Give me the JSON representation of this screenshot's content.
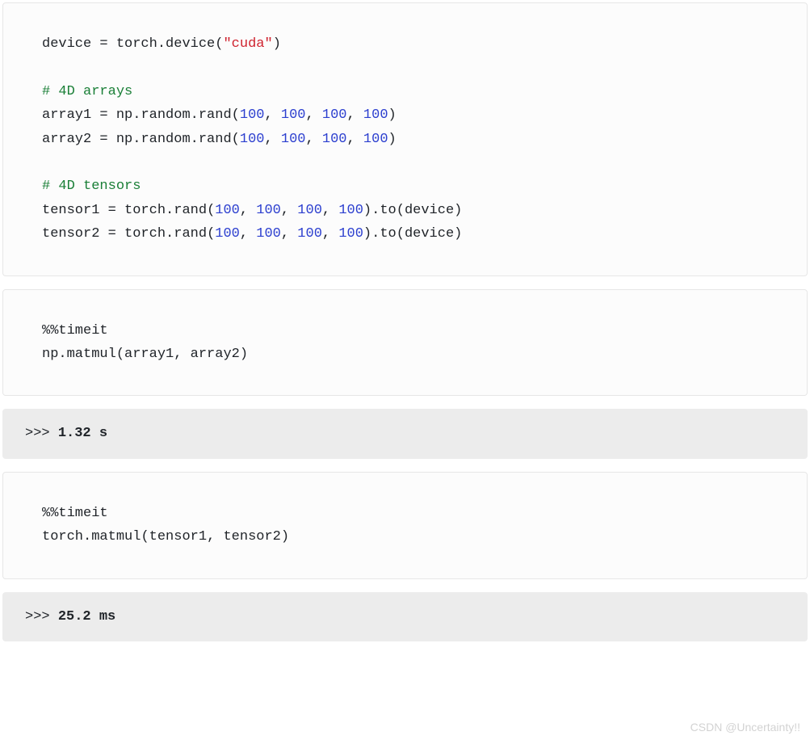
{
  "block1": {
    "l1_lhs": "device",
    "l1_eq": " = ",
    "l1_mod": "torch",
    "l1_dot1": ".",
    "l1_fn": "device",
    "l1_open": "(",
    "l1_str": "\"cuda\"",
    "l1_close": ")",
    "blank1": "",
    "c1": "# 4D arrays",
    "a1_lhs": "array1",
    "a1_eq": " = ",
    "a1_np": "np",
    "a1_d1": ".",
    "a1_rnd": "random",
    "a1_d2": ".",
    "a1_rand": "rand",
    "a1_open": "(",
    "a1_n1": "100",
    "a1_c1": ", ",
    "a1_n2": "100",
    "a1_c2": ", ",
    "a1_n3": "100",
    "a1_c3": ", ",
    "a1_n4": "100",
    "a1_close": ")",
    "a2_lhs": "array2",
    "a2_eq": " = ",
    "a2_np": "np",
    "a2_d1": ".",
    "a2_rnd": "random",
    "a2_d2": ".",
    "a2_rand": "rand",
    "a2_open": "(",
    "a2_n1": "100",
    "a2_c1": ", ",
    "a2_n2": "100",
    "a2_c2": ", ",
    "a2_n3": "100",
    "a2_c3": ", ",
    "a2_n4": "100",
    "a2_close": ")",
    "blank2": "",
    "c2": "# 4D tensors",
    "t1_lhs": "tensor1",
    "t1_eq": " = ",
    "t1_mod": "torch",
    "t1_d1": ".",
    "t1_rand": "rand",
    "t1_open": "(",
    "t1_n1": "100",
    "t1_c1": ", ",
    "t1_n2": "100",
    "t1_c2": ", ",
    "t1_n3": "100",
    "t1_c3": ", ",
    "t1_n4": "100",
    "t1_close": ")",
    "t1_d2": ".",
    "t1_to": "to",
    "t1_open2": "(",
    "t1_dev": "device",
    "t1_close2": ")",
    "t2_lhs": "tensor2",
    "t2_eq": " = ",
    "t2_mod": "torch",
    "t2_d1": ".",
    "t2_rand": "rand",
    "t2_open": "(",
    "t2_n1": "100",
    "t2_c1": ", ",
    "t2_n2": "100",
    "t2_c2": ", ",
    "t2_n3": "100",
    "t2_c3": ", ",
    "t2_n4": "100",
    "t2_close": ")",
    "t2_d2": ".",
    "t2_to": "to",
    "t2_open2": "(",
    "t2_dev": "device",
    "t2_close2": ")"
  },
  "block2": {
    "magic": "%%timeit",
    "np": "np",
    "d1": ".",
    "fn": "matmul",
    "open": "(",
    "arg1": "array1",
    "comma": ", ",
    "arg2": "array2",
    "close": ")"
  },
  "out1": {
    "prompt": ">>> ",
    "value": "1.32 s"
  },
  "block3": {
    "magic": "%%timeit",
    "mod": "torch",
    "d1": ".",
    "fn": "matmul",
    "open": "(",
    "arg1": "tensor1",
    "comma": ", ",
    "arg2": "tensor2",
    "close": ")"
  },
  "out2": {
    "prompt": ">>> ",
    "value": "25.2 ms"
  },
  "watermark": "CSDN @Uncertainty!!"
}
